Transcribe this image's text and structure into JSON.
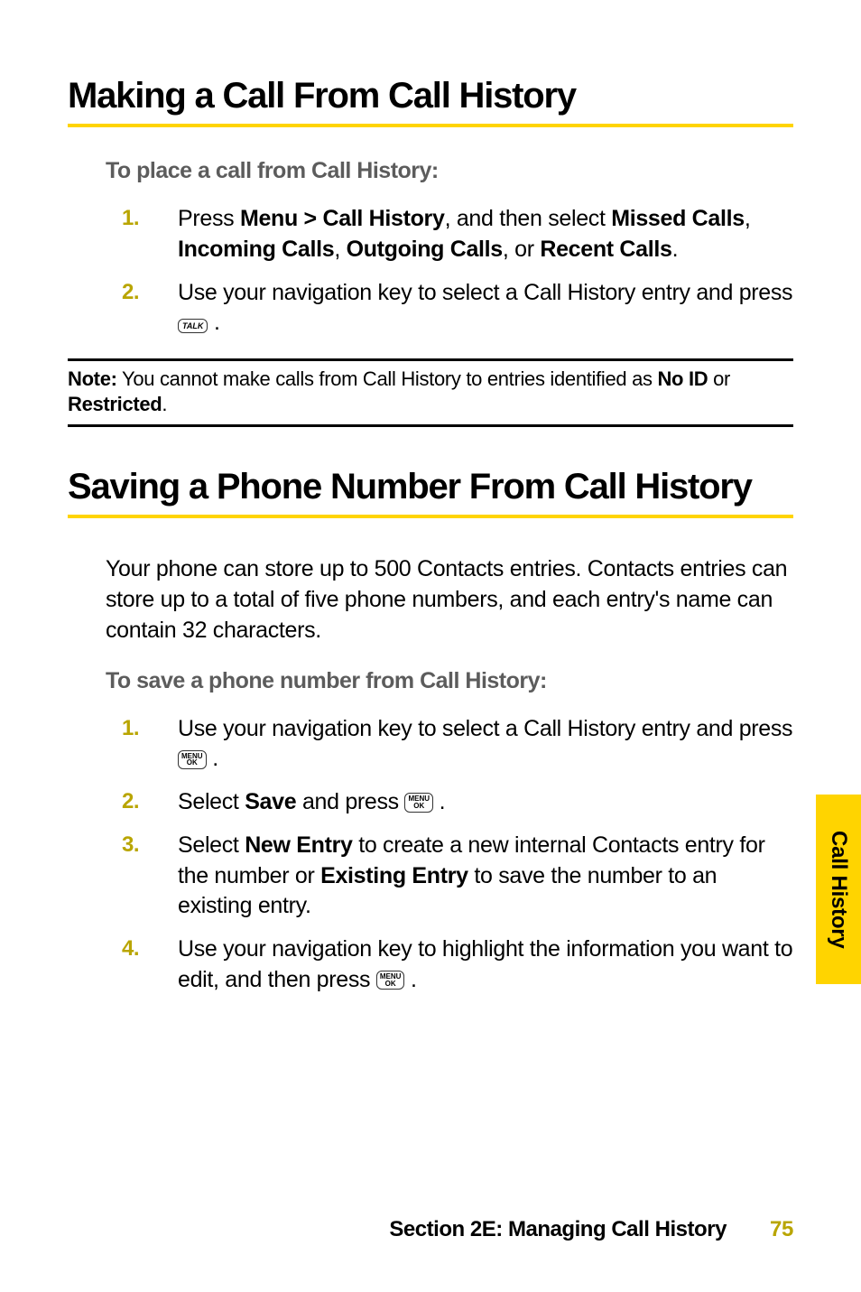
{
  "heading1": "Making a Call From Call History",
  "sub1": "To place a call from Call History:",
  "steps1": {
    "s1_a": "Press ",
    "s1_b": "Menu > Call History",
    "s1_c": ", and then select ",
    "s1_d": "Missed Calls",
    "s1_e": ", ",
    "s1_f": "Incoming Calls",
    "s1_g": ", ",
    "s1_h": "Outgoing Calls",
    "s1_i": ", or ",
    "s1_j": "Recent Calls",
    "s1_k": ".",
    "s2_a": "Use your navigation key to select a Call History entry and press ",
    "s2_b": " ."
  },
  "note": {
    "label": "Note:",
    "part1": " You cannot make calls from Call History to entries identified as ",
    "noid": "No ID",
    "part2": " or ",
    "restricted": "Restricted",
    "part3": "."
  },
  "heading2": "Saving a Phone Number From Call History",
  "body2": "Your phone can store up to 500 Contacts entries. Contacts entries can store up to a total of five phone numbers, and each entry's name can contain 32 characters.",
  "sub2": "To save a phone number from Call History:",
  "steps2": {
    "s1_a": "Use your navigation key to select a Call History entry and press ",
    "s1_b": " .",
    "s2_a": "Select ",
    "s2_b": "Save",
    "s2_c": " and press ",
    "s2_d": " .",
    "s3_a": "Select ",
    "s3_b": "New Entry",
    "s3_c": " to create a new internal Contacts entry for the number or ",
    "s3_d": "Existing Entry",
    "s3_e": " to save the number to an existing entry.",
    "s4_a": "Use your navigation key to highlight the information you want to edit, and then press ",
    "s4_b": " ."
  },
  "nums": {
    "n1": "1.",
    "n2": "2.",
    "n3": "3.",
    "n4": "4."
  },
  "icons": {
    "talk": "TALK",
    "menu": "MENU",
    "ok": "OK"
  },
  "sideTab": "Call History",
  "footer": {
    "section": "Section 2E: Managing Call History",
    "page": "75"
  }
}
